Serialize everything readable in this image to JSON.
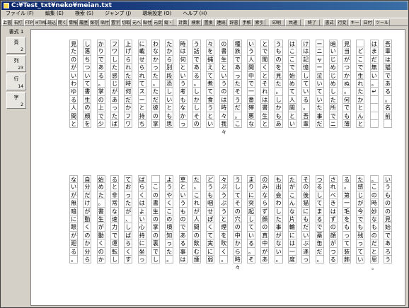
{
  "window": {
    "title": "C:¥Test_txt¥neko¥meian.txt"
  },
  "menu": [
    "ファイル (F)",
    "編集 (E)",
    "検索 (S)",
    "ジャンプ (J)",
    "環境設定 (O)",
    "ヘルプ (H)"
  ],
  "toolbar": [
    "上書",
    "右打",
    "FTP",
    "HTML",
    "読込",
    "開く",
    "情報",
    "履歴",
    "保存",
    "貼付",
    "置字",
    "切取",
    "元へ",
    "貼付",
    "元戻",
    "縦・",
    "計数",
    "検索",
    "置換",
    "連続",
    "辞書",
    "手帳",
    "索引",
    "印刷",
    "共通",
    "終了",
    "書式",
    "行変",
    "キー",
    "日付",
    "ツール"
  ],
  "side": {
    "head": "書式 1",
    "boxes": [
      {
        "label": "頁",
        "num": "2"
      },
      {
        "label": "列",
        "num": "23"
      },
      {
        "label": "行",
        "num": "14"
      },
      {
        "label": "字",
        "num": "2"
      }
    ]
  },
  "upper_columns": [
    "吾輩は猫である。名前",
    "はまだ無い。↵",
    "　どこで生れたかとんと",
    "見当がつかぬ。何でも薄",
    "暗いじめじめした所でニャ",
    "ーニャー泣いていた事だ",
    "けは記憶している。吾輩",
    "はここで始めて人間とい",
    "うものを見た。しかもあ",
    "とで聞くとそれは書生と",
    "いう人間中で一番獰悪な",
    "種族であったそうだ。こ",
    "の書生というのは時々我",
    "々を捕えて煮て食うとい",
    "う話である。しかしその当",
    "時は何という考もなかっ",
    "たから別段恐しいとも思",
    "わなかった。ただ彼の掌",
    "に載せられてスーと持ち",
    "上げられた時何だかフワ",
    "フワした感じがあったば",
    "かりである。掌の上で少",
    "し落ちついて書生の顔を",
    "見たのがいわゆる人間と"
  ],
  "upper_marks": [
    "",
    "",
    "",
    "",
    "",
    "",
    "",
    "",
    "",
    "",
    "",
    "",
    "々",
    "",
    "",
    "",
    "",
    "",
    "",
    "",
    "",
    "",
    "",
    ""
  ],
  "lower_columns": [
    "いうものの見始であろう",
    "。この時妙なものだと思っ",
    "た感じが今でも残ってい",
    "る。第一毛をもって装飾",
    "されべきはずの顔がつる",
    "つるしてまるで薬缶だ。",
    "その後猫にもだいぶ逢っ",
    "たがこんな片輪には一度",
    "も出会わした事がない。",
    "のみならず顔の真中があ",
    "まりに突起している。そ",
    "うしてその穴の中から時",
    "々ぷうぷうと煙を吹く。",
    "どうも咽せぽくて実に弱っ",
    "た。これが人間の飲む煙",
    "草というものである事は",
    "ようやくこの頃知った。↵",
    "　この書生の掌の裏でし",
    "ばらくはよい心持に坐っ",
    "ておったが、しばらくす",
    "ると非常な速力で運転し",
    "始めた。書生が動くのか",
    "自分だけが動くのか分ら",
    "ないが無暗に眼が廻る。"
  ],
  "lower_marks": [
    "",
    "。",
    "",
    "",
    "",
    "",
    "",
    "",
    "",
    "",
    "",
    "々",
    "",
    "",
    "",
    "",
    "",
    "",
    "",
    "",
    "",
    "",
    "",
    ""
  ]
}
